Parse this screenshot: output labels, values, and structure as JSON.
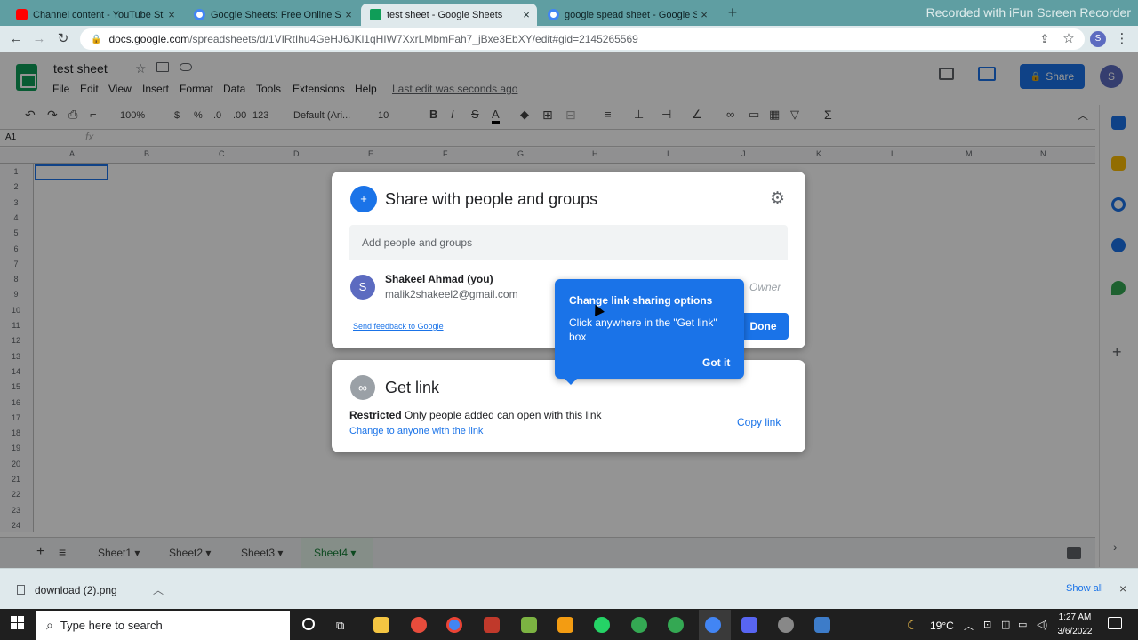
{
  "browser": {
    "tabs": [
      {
        "title": "Channel content - YouTube Studio",
        "fav": "#ff0000"
      },
      {
        "title": "Google Sheets: Free Online Spreadsheet",
        "fav": "#4285f4"
      },
      {
        "title": "test sheet - Google Sheets",
        "fav": "#0f9d58"
      },
      {
        "title": "google spead sheet - Google Search",
        "fav": "#4285f4"
      }
    ],
    "new_tab": "+",
    "recorder_watermark": "Recorded with iFun Screen Recorder",
    "url_host": "docs.google.com",
    "url_path": "/spreadsheets/d/1VIRtIhu4GeHJ6JKl1qHIW7XxrLMbmFah7_jBxe3EbXY/edit#gid=2145265569",
    "profile_initial": "S"
  },
  "sheets": {
    "doc_title": "test sheet",
    "menu": [
      "File",
      "Edit",
      "View",
      "Insert",
      "Format",
      "Data",
      "Tools",
      "Extensions",
      "Help"
    ],
    "last_edit": "Last edit was seconds ago",
    "share_label": "Share",
    "avatar_initial": "S",
    "toolbar": {
      "zoom": "100%",
      "currency": "$",
      "percent": "%",
      "dec_less": ".0",
      "dec_more": ".00",
      "format": "123",
      "font": "Default (Ari...",
      "size": "10"
    },
    "cell_ref": "A1",
    "fx": "fx",
    "columns": [
      "A",
      "B",
      "C",
      "D",
      "E",
      "F",
      "G",
      "H",
      "I",
      "J",
      "K",
      "L",
      "M",
      "N"
    ],
    "rows": [
      "1",
      "2",
      "3",
      "4",
      "5",
      "6",
      "7",
      "8",
      "9",
      "10",
      "11",
      "12",
      "13",
      "14",
      "15",
      "16",
      "17",
      "18",
      "19",
      "20",
      "21",
      "22",
      "23",
      "24"
    ],
    "sheet_tabs": [
      "Sheet1",
      "Sheet2",
      "Sheet3",
      "Sheet4"
    ],
    "active_sheet": "Sheet4"
  },
  "share_dialog": {
    "title": "Share with people and groups",
    "add_placeholder": "Add people and groups",
    "user_initial": "S",
    "user_name": "Shakeel Ahmad (you)",
    "user_email": "malik2shakeel2@gmail.com",
    "user_role": "Owner",
    "feedback": "Send feedback to Google",
    "done_label": "Done"
  },
  "get_link": {
    "title": "Get link",
    "restricted_label": "Restricted",
    "restricted_desc": " Only people added can open with this link",
    "change_label": "Change to anyone with the link",
    "copy_label": "Copy link"
  },
  "tooltip": {
    "title": "Change link sharing options",
    "body": "Click anywhere in the \"Get link\" box",
    "got_it": "Got it"
  },
  "download_bar": {
    "file": "download (2).png",
    "show_all": "Show all"
  },
  "taskbar": {
    "search_placeholder": "Type here to search",
    "weather": "19°C",
    "time": "1:27 AM",
    "date": "3/6/2022"
  },
  "colors": {
    "accent": "#1a73e8",
    "sheets_green": "#0f9d58",
    "browser_frame": "#5f9ea2"
  }
}
